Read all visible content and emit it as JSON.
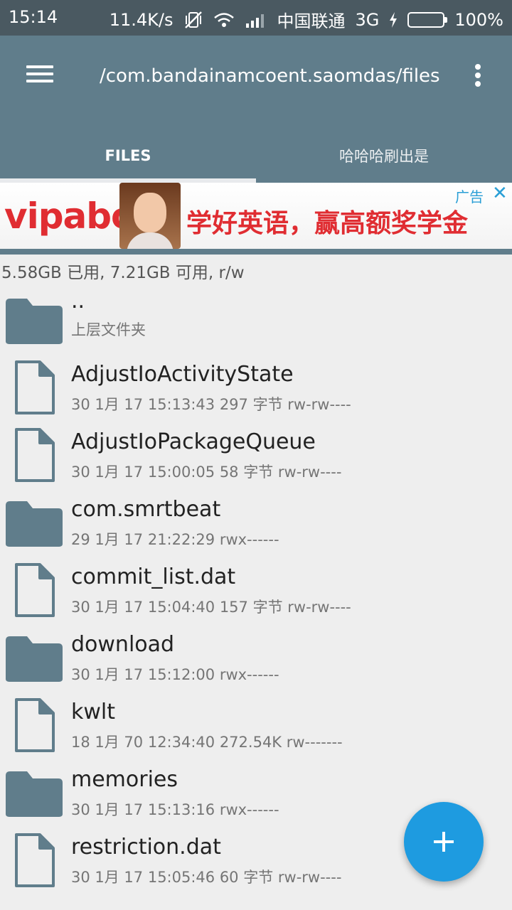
{
  "status_bar": {
    "time": "15:14",
    "net_speed": "11.4K/s",
    "carrier": "中国联通",
    "network": "3G",
    "battery": "100%",
    "battery_color": "#6ad32c"
  },
  "app_bar": {
    "path": "/com.bandainamcoent.saomdas/files",
    "menu_icon": "hamburger-menu-icon",
    "overflow_icon": "more-vert-icon",
    "color": "#607d8b"
  },
  "tabs": [
    {
      "label": "FILES",
      "active": true
    },
    {
      "label": "哈哈哈刷出是",
      "active": false
    }
  ],
  "ad": {
    "logo": "vipabc",
    "slogan": "学好英语，赢高额奖学金",
    "label": "广告",
    "close": "✕"
  },
  "storage": "5.58GB 已用, 7.21GB 可用, r/w",
  "files": [
    {
      "type": "folder",
      "name": "..",
      "meta": "上层文件夹"
    },
    {
      "type": "file",
      "name": "AdjustIoActivityState",
      "meta": "30 1月 17 15:13:43  297 字节  rw-rw----"
    },
    {
      "type": "file",
      "name": "AdjustIoPackageQueue",
      "meta": "30 1月 17 15:00:05  58 字节  rw-rw----"
    },
    {
      "type": "folder",
      "name": "com.smrtbeat",
      "meta": "29 1月 17 21:22:29    rwx------"
    },
    {
      "type": "file",
      "name": "commit_list.dat",
      "meta": "30 1月 17 15:04:40  157 字节  rw-rw----"
    },
    {
      "type": "folder",
      "name": "download",
      "meta": "30 1月 17 15:12:00    rwx------"
    },
    {
      "type": "file",
      "name": "kwlt",
      "meta": "18 1月 70 12:34:40  272.54K  rw-------"
    },
    {
      "type": "folder",
      "name": "memories",
      "meta": "30 1月 17 15:13:16    rwx------"
    },
    {
      "type": "file",
      "name": "restriction.dat",
      "meta": "30 1月 17 15:05:46  60 字节  rw-rw----"
    }
  ],
  "fab": {
    "label": "+",
    "icon": "add-icon",
    "color": "#1e9be0"
  }
}
